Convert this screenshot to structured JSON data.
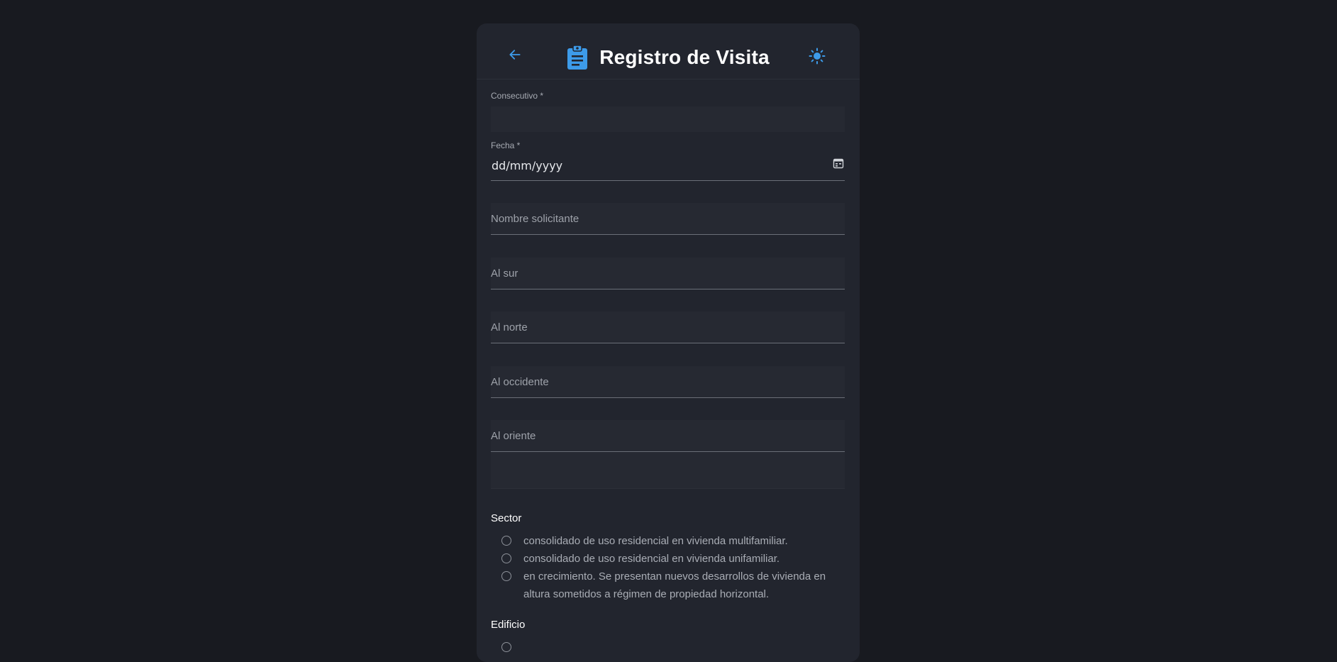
{
  "header": {
    "title": "Registro de Visita",
    "back_icon": "arrow-left-icon",
    "title_icon": "clipboard-icon",
    "theme_icon": "sun-icon",
    "accent_color": "#3d9be9"
  },
  "form": {
    "consecutivo": {
      "label": "Consecutivo *",
      "value": ""
    },
    "fecha": {
      "label": "Fecha *",
      "value": "dd/mm/yyyy",
      "icon": "calendar-icon"
    },
    "nombre_solicitante": {
      "placeholder": "Nombre solicitante"
    },
    "al_sur": {
      "placeholder": "Al sur"
    },
    "al_norte": {
      "placeholder": "Al norte"
    },
    "al_occidente": {
      "placeholder": "Al occidente"
    },
    "al_oriente": {
      "placeholder": "Al oriente"
    }
  },
  "sector": {
    "title": "Sector",
    "options": [
      "consolidado de uso residencial en vivienda multifamiliar.",
      "consolidado de uso residencial en vivienda unifamiliar.",
      "en crecimiento. Se presentan nuevos desarrollos de vivienda en altura sometidos a régimen de propiedad horizontal."
    ]
  },
  "edificio": {
    "title": "Edificio"
  }
}
